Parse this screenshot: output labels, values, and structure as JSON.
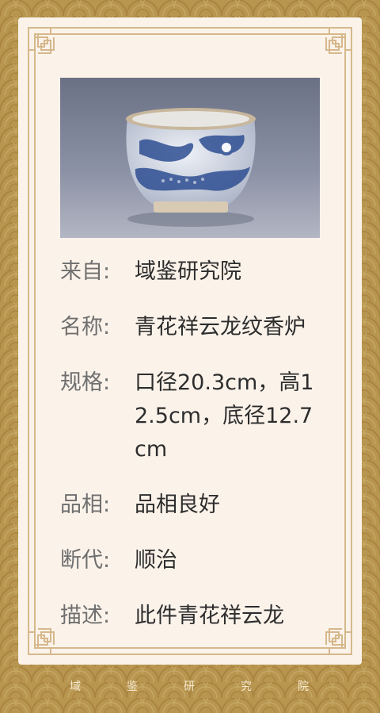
{
  "card": {
    "fields": [
      {
        "label": "来自:",
        "value": "域鉴研究院"
      },
      {
        "label": "名称:",
        "value": "青花祥云龙纹香炉"
      },
      {
        "label": "规格:",
        "value": " 口径20.3cm，高12.5cm，底径12.7cm"
      },
      {
        "label": "品相:",
        "value": "品相良好"
      },
      {
        "label": "断代:",
        "value": "顺治"
      },
      {
        "label": "描述:",
        "value": "此件青花祥云龙"
      }
    ]
  },
  "footer": {
    "chars": [
      "域",
      "鉴",
      "研",
      "究",
      "院"
    ]
  },
  "colors": {
    "background": "#b8964f",
    "card": "#fbf3ea",
    "frame": "#d6b88c",
    "label": "#6f6f6f",
    "value": "#2d2d2d"
  }
}
